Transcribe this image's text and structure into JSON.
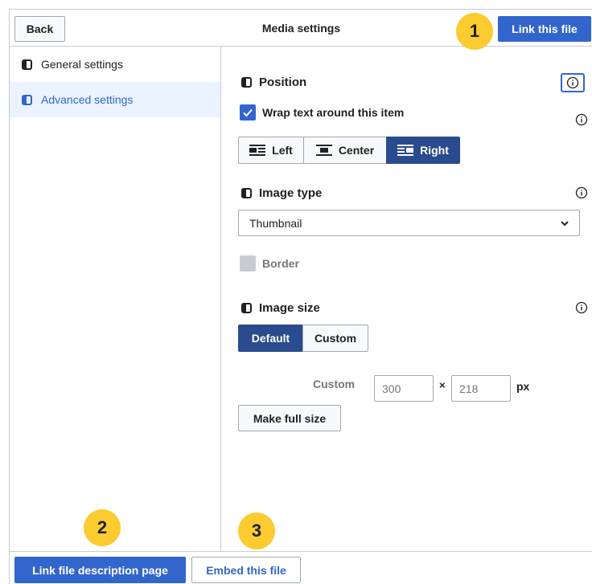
{
  "header": {
    "back_label": "Back",
    "title": "Media settings",
    "link_file_label": "Link this file"
  },
  "sidebar": {
    "items": [
      {
        "label": "General settings",
        "active": false
      },
      {
        "label": "Advanced settings",
        "active": true
      }
    ]
  },
  "position": {
    "title": "Position",
    "wrap_label": "Wrap text around this item",
    "wrap_checked": true,
    "alignment": [
      {
        "label": "Left",
        "selected": false,
        "icon": "align-left-icon"
      },
      {
        "label": "Center",
        "selected": false,
        "icon": "align-center-icon"
      },
      {
        "label": "Right",
        "selected": true,
        "icon": "align-right-icon"
      }
    ]
  },
  "image_type": {
    "title": "Image type",
    "selected": "Thumbnail"
  },
  "border": {
    "label": "Border",
    "checked": false,
    "disabled": true
  },
  "image_size": {
    "title": "Image size",
    "options": [
      {
        "label": "Default",
        "selected": true
      },
      {
        "label": "Custom",
        "selected": false
      }
    ],
    "custom_label": "Custom",
    "width_placeholder": "300",
    "height_placeholder": "218",
    "times": "×",
    "unit": "px",
    "full_size_label": "Make full size"
  },
  "footer": {
    "link_description_label": "Link file description page",
    "embed_label": "Embed this file"
  },
  "callouts": [
    "1",
    "2",
    "3"
  ],
  "colors": {
    "accent": "#3366cc",
    "selected_dark": "#2a4b8d",
    "active_bg": "#eaf3ff",
    "callout": "#fccb30",
    "border": "#c8ccd1"
  }
}
